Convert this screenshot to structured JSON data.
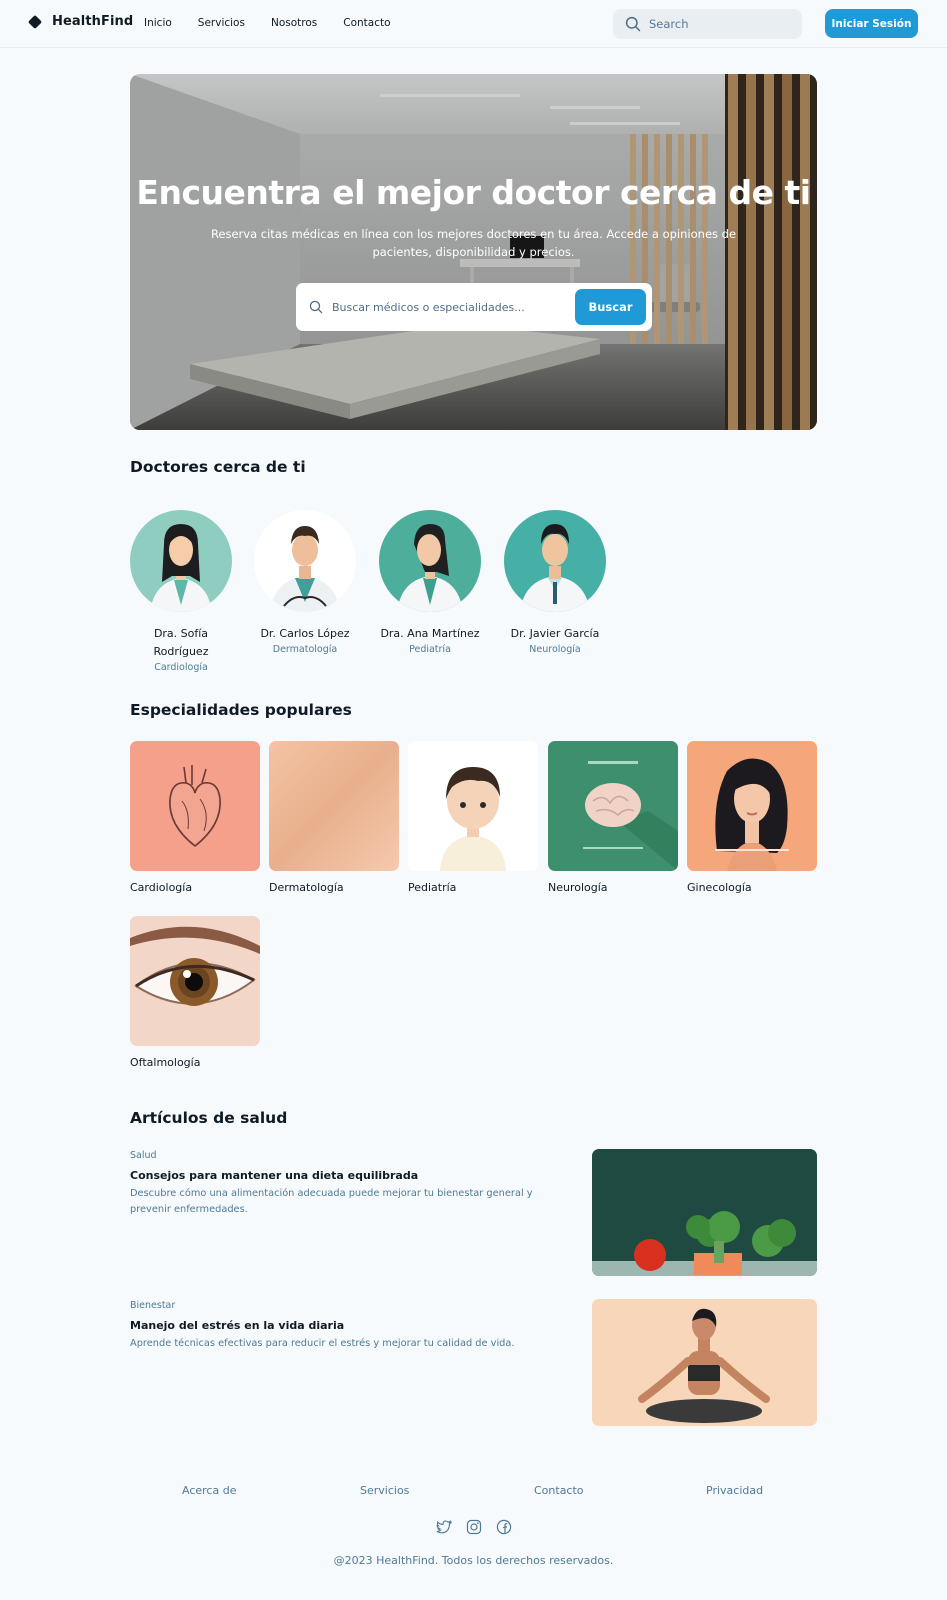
{
  "header": {
    "brand": "HealthFind",
    "nav": [
      "Inicio",
      "Servicios",
      "Nosotros",
      "Contacto"
    ],
    "search_placeholder": "Search",
    "login_label": "Iniciar Sesión"
  },
  "hero": {
    "title": "Encuentra el mejor doctor cerca de ti",
    "subtitle": "Reserva citas médicas en línea con los mejores doctores en tu área. Accede a opiniones de pacientes, disponibilidad y precios.",
    "search_placeholder": "Buscar médicos o especialidades...",
    "search_button": "Buscar"
  },
  "doctors_section": {
    "title": "Doctores cerca de ti",
    "items": [
      {
        "name": "Dra. Sofía Rodríguez",
        "specialty": "Cardiología"
      },
      {
        "name": "Dr. Carlos López",
        "specialty": "Dermatología"
      },
      {
        "name": "Dra. Ana Martínez",
        "specialty": "Pediatría"
      },
      {
        "name": "Dr. Javier García",
        "specialty": "Neurología"
      }
    ]
  },
  "specialties_section": {
    "title": "Especialidades populares",
    "items": [
      "Cardiología",
      "Dermatología",
      "Pediatría",
      "Neurología",
      "Ginecología",
      "Oftalmología"
    ]
  },
  "articles_section": {
    "title": "Artículos de salud",
    "items": [
      {
        "category": "Salud",
        "title": "Consejos para mantener una dieta equilibrada",
        "description": "Descubre cómo una alimentación adecuada puede mejorar tu bienestar general y prevenir enfermedades."
      },
      {
        "category": "Bienestar",
        "title": "Manejo del estrés en la vida diaria",
        "description": "Aprende técnicas efectivas para reducir el estrés y mejorar tu calidad de vida."
      }
    ]
  },
  "footer": {
    "links": [
      "Acerca de",
      "Servicios",
      "Contacto",
      "Privacidad"
    ],
    "socials": [
      "twitter-icon",
      "instagram-icon",
      "facebook-icon"
    ],
    "copyright": "@2023 HealthFind. Todos los derechos reservados."
  },
  "colors": {
    "accent": "#1f9ad6",
    "muted_text": "#4f7a96",
    "background": "#f7fafc"
  }
}
